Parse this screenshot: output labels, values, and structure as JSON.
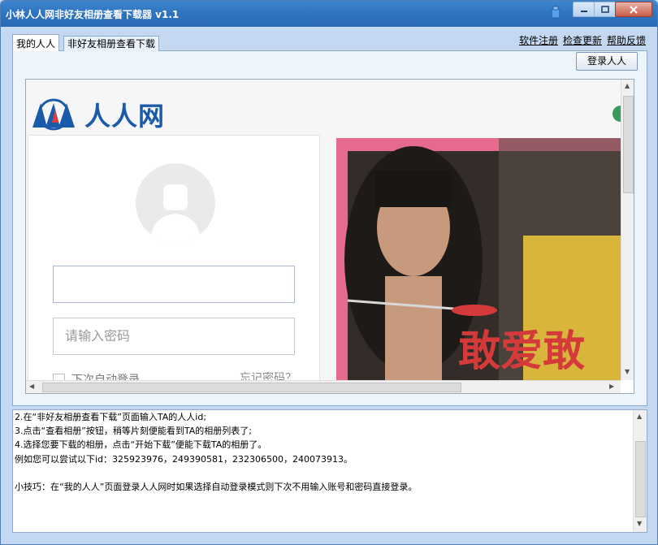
{
  "window": {
    "title": "小林人人网非好友相册查看下载器 v1.1"
  },
  "tabs": [
    {
      "label": "我的人人",
      "active": true
    },
    {
      "label": "非好友相册查看下载",
      "active": false
    }
  ],
  "top_links": [
    "软件注册",
    "检查更新",
    "帮助反馈"
  ],
  "login_button": "登录人人",
  "web": {
    "logo_text": "人人网",
    "password_placeholder": "请输入密码",
    "remember_label": "下次自动登录",
    "forgot_label": "忘记密码？",
    "promo_text": "敢爱敢"
  },
  "log": {
    "lines": [
      "2.在“非好友相册查看下载”页面输入TA的人人id;",
      "3.点击“查看相册”按钮，稍等片刻便能看到TA的相册列表了;",
      "4.选择您要下载的相册，点击“开始下载”便能下载TA的相册了。",
      "例如您可以尝试以下id：325923976，249390581，232306500，240073913。",
      "",
      "小技巧：在“我的人人”页面登录人人网时如果选择自动登录模式则下次不用输入账号和密码直接登录。"
    ]
  },
  "colors": {
    "titlebar": "#2e73bf",
    "window_bg": "#c4d9f1",
    "logo_blue": "#1b5aa8",
    "promo_pink": "#e56a8d"
  }
}
